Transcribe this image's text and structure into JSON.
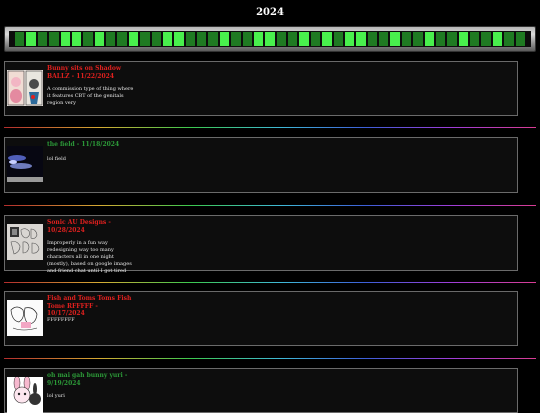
{
  "page": {
    "year": "2024"
  },
  "marquee": {
    "cells": [
      0,
      1,
      0,
      0,
      1,
      1,
      0,
      1,
      0,
      0,
      1,
      0,
      0,
      1,
      1,
      0,
      0,
      0,
      1,
      0,
      0,
      1,
      1,
      0,
      0,
      1,
      0,
      1,
      0,
      1,
      1,
      0,
      0,
      1,
      0,
      0,
      1,
      0,
      0,
      1,
      0,
      0,
      1,
      0,
      0
    ],
    "bright_color": "#49f04d",
    "dim_color": "#1f7a22"
  },
  "posts": [
    {
      "title": "Bunny sits on Shadow BALLZ - 11/22/2024",
      "title_color": "#e0201e",
      "description": "A commission type of thing where it features CBT of the genitals region very"
    },
    {
      "title": "the field - 11/18/2024",
      "title_color": "#2c9a38",
      "description": "lol field"
    },
    {
      "title": "Sonic AU Designs - 10/28/2024",
      "title_color": "#e0201e",
      "description": "Improperly in a fun way redesigning way too many characters all in one night (mostly), based on google images and friend chat until I got tired"
    },
    {
      "title": "Fish and Toms Toms Fish Tome RFFFFF - 10/17/2024",
      "title_color": "#e0201e",
      "description": "FFFFFFFF"
    },
    {
      "title": "oh mai gah bunny yuri - 9/19/2024",
      "title_color": "#2c9a38",
      "description": "lol yuri"
    }
  ]
}
